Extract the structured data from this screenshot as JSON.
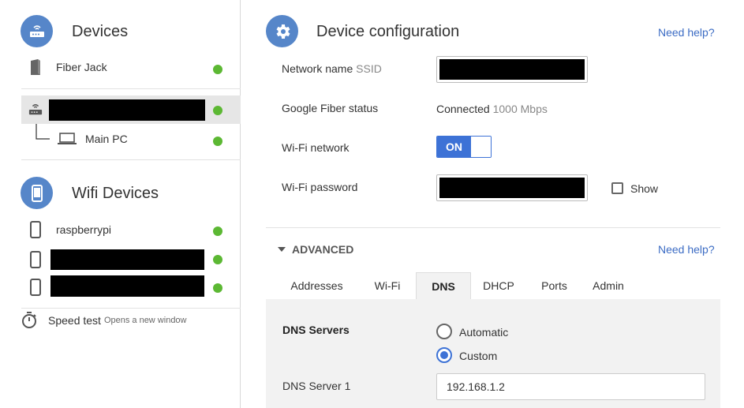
{
  "sidebar": {
    "devices_title": "Devices",
    "devices": [
      {
        "label": "Fiber Jack",
        "icon": "fiber-jack-icon",
        "status": "online"
      },
      {
        "label": "",
        "icon": "router-icon",
        "status": "online",
        "redacted": true,
        "selected": true
      },
      {
        "label": "Main PC",
        "icon": "laptop-icon",
        "status": "online",
        "child": true
      }
    ],
    "wifi_title": "Wifi Devices",
    "wifi_devices": [
      {
        "label": "raspberrypi",
        "icon": "phone-icon",
        "status": "online"
      },
      {
        "label": "",
        "icon": "phone-icon",
        "status": "online",
        "redacted": true
      },
      {
        "label": "",
        "icon": "phone-icon",
        "status": "online",
        "redacted": true
      }
    ],
    "speed_test": {
      "label": "Speed test",
      "sub": "Opens a new window"
    }
  },
  "main": {
    "title": "Device configuration",
    "help": "Need help?",
    "fields": {
      "network_name_label": "Network name",
      "network_name_suffix": "SSID",
      "fiber_status_label": "Google Fiber status",
      "fiber_status_value": "Connected",
      "fiber_status_speed": "1000 Mbps",
      "wifi_network_label": "Wi-Fi network",
      "wifi_toggle": "ON",
      "wifi_password_label": "Wi-Fi password",
      "show_label": "Show"
    },
    "advanced": {
      "label": "ADVANCED",
      "help": "Need help?",
      "tabs": [
        "Addresses",
        "Wi-Fi",
        "DNS",
        "DHCP",
        "Ports",
        "Admin"
      ],
      "active_tab": "DNS",
      "dns": {
        "title": "DNS Servers",
        "option_automatic": "Automatic",
        "option_custom": "Custom",
        "selected": "Custom",
        "server1_label": "DNS Server 1",
        "server1_value": "192.168.1.2"
      }
    }
  },
  "colors": {
    "accent": "#5686c9",
    "toggle_blue": "#3d72d6",
    "status_green": "#5cb833",
    "link": "#3c6cc4"
  }
}
